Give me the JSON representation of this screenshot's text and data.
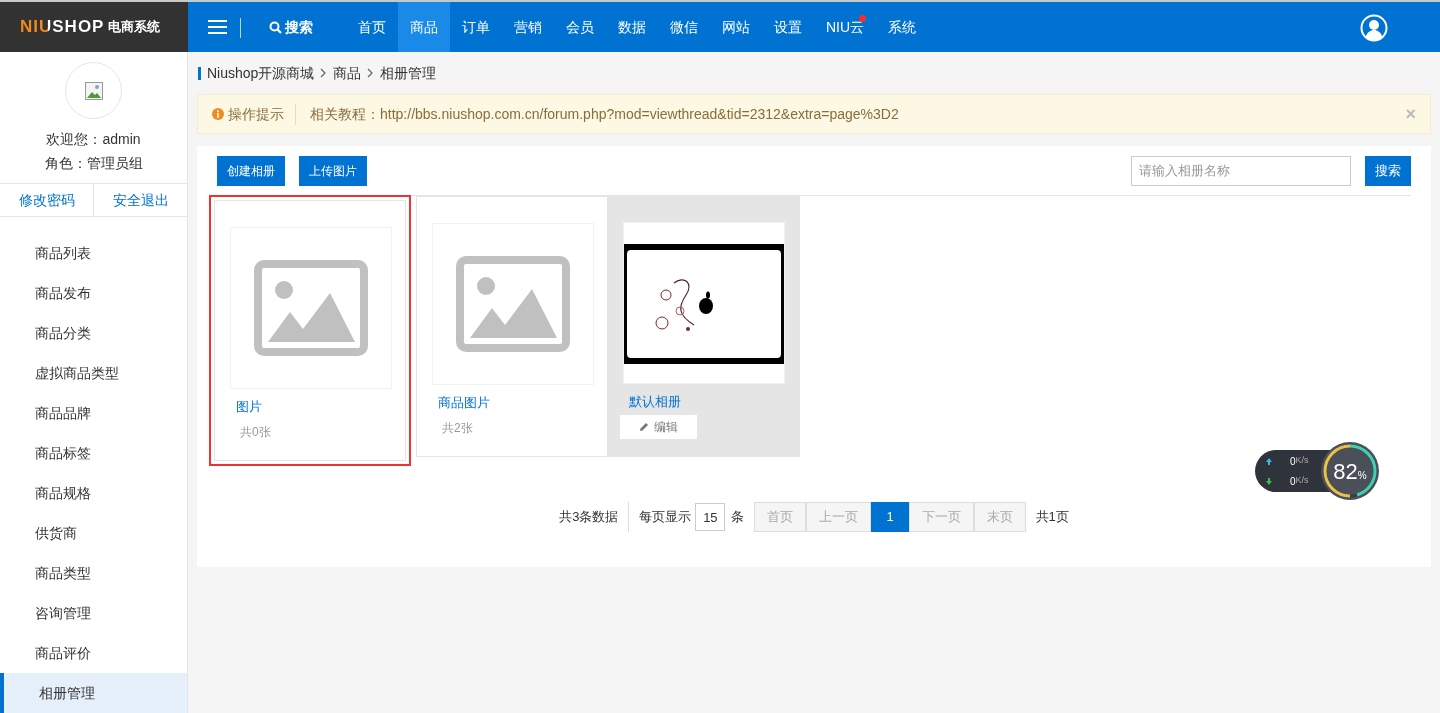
{
  "header": {
    "logo_brand": "NIUSHOP",
    "logo_suffix": "电商系统",
    "search": "搜索",
    "nav": [
      {
        "label": "首页",
        "selected": false,
        "badge": false
      },
      {
        "label": "商品",
        "selected": true,
        "badge": false
      },
      {
        "label": "订单",
        "selected": false,
        "badge": false
      },
      {
        "label": "营销",
        "selected": false,
        "badge": false
      },
      {
        "label": "会员",
        "selected": false,
        "badge": false
      },
      {
        "label": "数据",
        "selected": false,
        "badge": false
      },
      {
        "label": "微信",
        "selected": false,
        "badge": false
      },
      {
        "label": "网站",
        "selected": false,
        "badge": false
      },
      {
        "label": "设置",
        "selected": false,
        "badge": false
      },
      {
        "label": "NIU云",
        "selected": false,
        "badge": true
      },
      {
        "label": "系统",
        "selected": false,
        "badge": false
      }
    ]
  },
  "sidebar": {
    "welcome": "欢迎您：admin",
    "role": "角色：管理员组",
    "links": [
      "修改密码",
      "安全退出"
    ],
    "items": [
      {
        "label": "商品列表",
        "selected": false
      },
      {
        "label": "商品发布",
        "selected": false
      },
      {
        "label": "商品分类",
        "selected": false
      },
      {
        "label": "虚拟商品类型",
        "selected": false
      },
      {
        "label": "商品品牌",
        "selected": false
      },
      {
        "label": "商品标签",
        "selected": false
      },
      {
        "label": "商品规格",
        "selected": false
      },
      {
        "label": "供货商",
        "selected": false
      },
      {
        "label": "商品类型",
        "selected": false
      },
      {
        "label": "咨询管理",
        "selected": false
      },
      {
        "label": "商品评价",
        "selected": false
      },
      {
        "label": "相册管理",
        "selected": true
      }
    ]
  },
  "breadcrumb": [
    "Niushop开源商城",
    "商品",
    "相册管理"
  ],
  "tip": {
    "title": "操作提示",
    "text": "相关教程：http://bbs.niushop.com.cn/forum.php?mod=viewthread&tid=2312&extra=page%3D2",
    "close": "×"
  },
  "toolbar": {
    "buttons": [
      "创建相册",
      "上传图片"
    ],
    "search": {
      "placeholder": "请输入相册名称"
    },
    "search_button": "搜索"
  },
  "albums": [
    {
      "name": "图片",
      "count": "共0张",
      "kind": "placeholder",
      "outlined": true,
      "hovered": false
    },
    {
      "name": "商品图片",
      "count": "共2张",
      "kind": "placeholder",
      "outlined": false,
      "hovered": false
    },
    {
      "name": "默认相册",
      "kind": "picture",
      "outlined": false,
      "hovered": true,
      "edit": "编辑"
    }
  ],
  "pagination": {
    "total": "共3条数据",
    "per_page_label": "每页显示",
    "per_page": "15",
    "unit": "条",
    "pages": [
      {
        "label": "首页",
        "selected": false,
        "disabled": true
      },
      {
        "label": "上一页",
        "selected": false,
        "disabled": true
      },
      {
        "label": "1",
        "selected": true,
        "disabled": false
      },
      {
        "label": "下一页",
        "selected": false,
        "disabled": true
      },
      {
        "label": "末页",
        "selected": false,
        "disabled": true
      }
    ],
    "page_count": "共1页"
  },
  "speed_widget": {
    "up": "0",
    "up_unit": "K/s",
    "down": "0",
    "down_unit": "K/s",
    "percent": "82",
    "percent_sign": "%"
  }
}
